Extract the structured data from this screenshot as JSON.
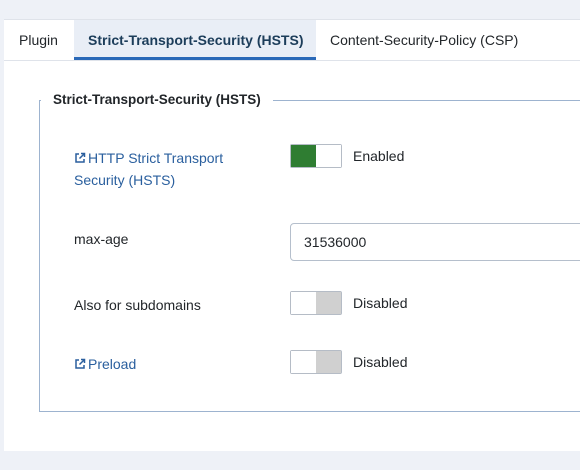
{
  "tabs": [
    {
      "label": "Plugin",
      "active": false
    },
    {
      "label": "Strict-Transport-Security (HSTS)",
      "active": true
    },
    {
      "label": "Content-Security-Policy (CSP)",
      "active": false
    }
  ],
  "fieldset": {
    "legend": "Strict-Transport-Security (HSTS)"
  },
  "fields": {
    "hsts": {
      "label_line1": "HTTP Strict Transport",
      "label_line2": "Security (HSTS)",
      "state": "Enabled",
      "on": true,
      "icon": "external-link-icon"
    },
    "max_age": {
      "label": "max-age",
      "value": "31536000"
    },
    "subdomains": {
      "label": "Also for subdomains",
      "state": "Disabled",
      "on": false
    },
    "preload": {
      "label": "Preload",
      "state": "Disabled",
      "on": false,
      "icon": "external-link-icon"
    }
  },
  "colors": {
    "accent": "#2a69b8",
    "link": "#2a5f9e",
    "switch_on": "#2f7d32",
    "switch_off": "#d0d0d0",
    "background": "#eef1f7"
  }
}
